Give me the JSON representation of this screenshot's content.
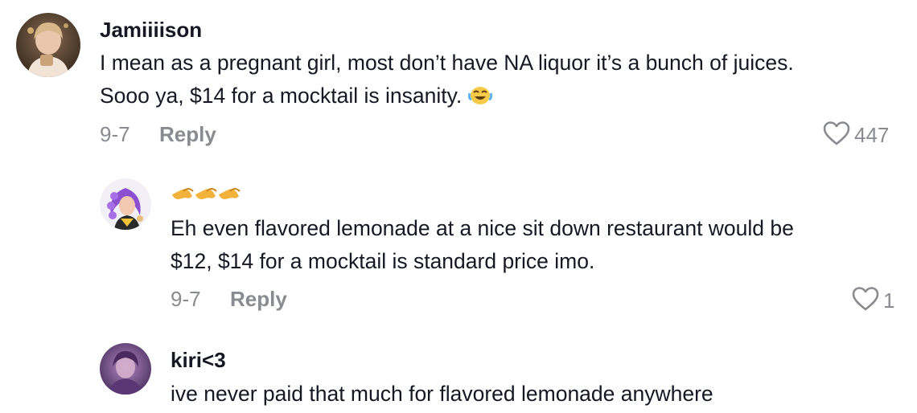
{
  "comments": [
    {
      "username": "Jamiiiison",
      "lines": [
        "I mean as a pregnant girl, most don’t have NA liquor it’s a bunch of juices.",
        "Sooo ya, $14 for a mocktail is insanity."
      ],
      "emoji": "face-with-tears-of-joy-icon",
      "date": "9-7",
      "reply_label": "Reply",
      "likes": "447"
    },
    {
      "username": "",
      "username_icons": [
        "pinching-hand-icon",
        "pinching-hand-icon",
        "pinching-hand-icon"
      ],
      "lines": [
        "Eh even flavored lemonade at a nice sit down restaurant would be",
        "$12, $14 for a mocktail is standard price imo."
      ],
      "date": "9-7",
      "reply_label": "Reply",
      "likes": "1"
    },
    {
      "username": "kiri<3",
      "lines": [
        "ive never paid that much for flavored lemonade anywhere"
      ]
    }
  ],
  "colors": {
    "text": "#161823",
    "muted": "#8a8b91",
    "heart_stroke": "#8a8b91"
  }
}
